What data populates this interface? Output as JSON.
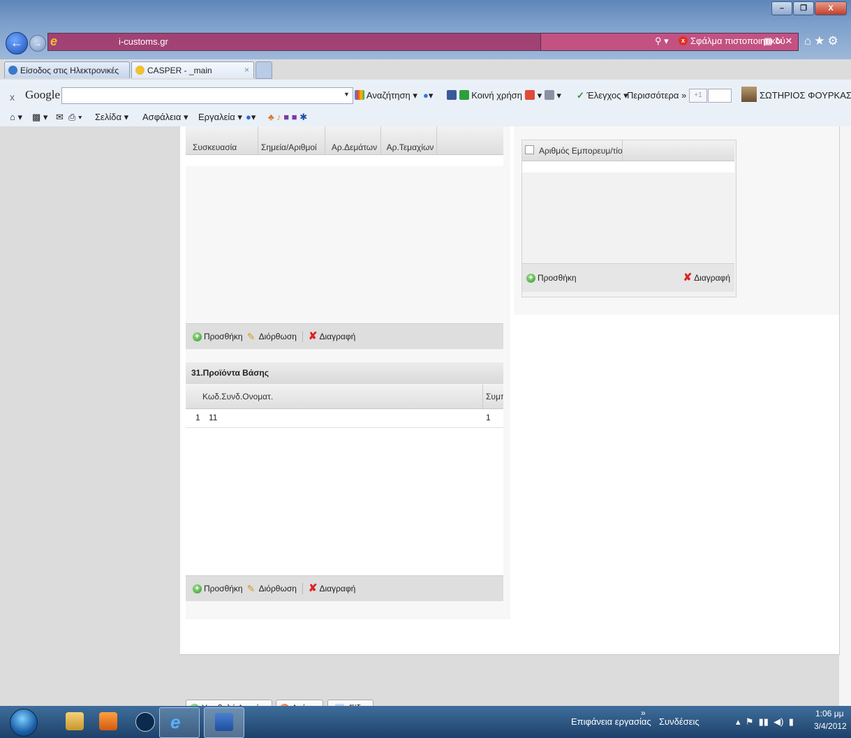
{
  "browser": {
    "address_text": "i-customs.gr",
    "cert_error": "Σφάλμα πιστοποιητικού",
    "window_controls": [
      "–",
      "❐",
      "X"
    ],
    "tabs": [
      {
        "label": "Είσοδος στις Ηλεκτρονικές Υπ..."
      },
      {
        "label": "CASPER - _main"
      }
    ],
    "tab_close": "×"
  },
  "google_bar": {
    "close": "x",
    "logo": "Google",
    "search_label": "Αναζήτηση",
    "share_label": "Κοινή χρήση",
    "check_label": "Έλεγχος",
    "more_label": "Περισσότερα »",
    "plus_label": "+1",
    "user_name": "ΣΩΤΗΡΙΟΣ ΦΟΥΡΚΑΣ"
  },
  "command_bar": {
    "page": "Σελίδα",
    "safety": "Ασφάλεια",
    "tools": "Εργαλεία"
  },
  "left_grid": {
    "columns": [
      "Συσκευασία",
      "Σημεία/Αριθμοί",
      "Αρ.Δεμάτων",
      "Αρ.Τεμαχίων"
    ],
    "toolbar": {
      "add": "Προσθήκη",
      "edit": "Διόρθωση",
      "delete": "Διαγραφή"
    }
  },
  "right_grid": {
    "columns": [
      "Αριθμός Εμπορευμ/τίου"
    ],
    "toolbar": {
      "add": "Προσθήκη",
      "delete": "Διαγραφή"
    }
  },
  "base_products": {
    "title": "31.Προϊόντα Βάσης",
    "columns": [
      "Κωδ.Συνδ.Ονοματ.",
      "Συμπ"
    ],
    "rows": [
      {
        "num": "1",
        "code": "11",
        "val": "1"
      }
    ],
    "toolbar": {
      "add": "Προσθήκη",
      "edit": "Διόρθωση",
      "delete": "Διαγραφή"
    }
  },
  "actions": {
    "submit": "Υποβολή Διασάφησης",
    "cancel": "Ακύρωση",
    "items": "Είδη"
  },
  "taskbar": {
    "desktop": "Επιφάνεια εργασίας",
    "chevron": "»",
    "connections": "Συνδέσεις",
    "time": "1:06 μμ",
    "date": "3/4/2012"
  },
  "colors": {
    "address_bar": "#a33a6c",
    "taskbar": "#1d4169",
    "panel_bg": "#f7f7f7",
    "toolbar_bg": "#dedede"
  }
}
